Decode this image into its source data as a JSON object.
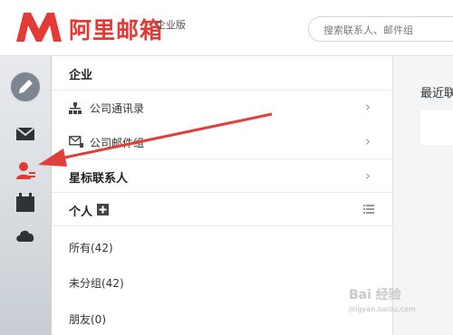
{
  "header": {
    "brand": "阿里邮箱",
    "edition": "企业版",
    "search_placeholder": "搜索联系人、邮件组"
  },
  "rail": {
    "items": [
      "pencil-icon",
      "mail-icon",
      "contacts-icon",
      "calendar-icon",
      "cloud-icon"
    ],
    "active_color": "#e23b35"
  },
  "contacts": {
    "enterprise_heading": "企业",
    "company_directory": "公司通讯录",
    "company_mail_groups": "公司邮件组",
    "starred": "星标联系人",
    "personal_heading": "个人",
    "groups": [
      {
        "label": "所有(42)"
      },
      {
        "label": "未分组(42)"
      },
      {
        "label": "朋友(0)"
      }
    ]
  },
  "right_panel": {
    "title": "最近联"
  },
  "watermark": {
    "text": "Bai 经验",
    "url": "jingyan.baidu.com"
  },
  "colors": {
    "brand": "#e23b35",
    "arrow": "#e0403a"
  }
}
